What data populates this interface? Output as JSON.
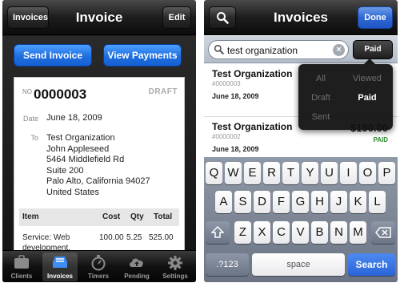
{
  "left_screen": {
    "nav": {
      "back_label": "Invoices",
      "title": "Invoice",
      "edit_label": "Edit"
    },
    "actions": {
      "send_label": "Send Invoice",
      "view_label": "View Payments"
    },
    "invoice": {
      "no_label": "NO",
      "number": "0000003",
      "status": "DRAFT",
      "date_label": "Date",
      "date": "June 18, 2009",
      "to_label": "To",
      "to_lines": [
        "Test Organization",
        "John Appleseed",
        "5464 Middlefield Rd",
        "Suite 200",
        "Palo Alto, California 94027",
        "United States"
      ],
      "table": {
        "headers": [
          "Item",
          "Cost",
          "Qty",
          "Total"
        ],
        "rows": [
          {
            "item": "Service: Web development.",
            "cost": "100.00",
            "qty": "5.25",
            "total": "525.00"
          }
        ]
      }
    },
    "tabs": [
      {
        "label": "Clients",
        "icon": "briefcase-icon",
        "active": false
      },
      {
        "label": "Invoices",
        "icon": "invoice-tray-icon",
        "active": true
      },
      {
        "label": "Timers",
        "icon": "stopwatch-icon",
        "active": false
      },
      {
        "label": "Pending",
        "icon": "cloud-upload-icon",
        "active": false
      },
      {
        "label": "Settings",
        "icon": "gear-icon",
        "active": false
      }
    ]
  },
  "right_screen": {
    "nav": {
      "title": "Invoices",
      "done_label": "Done",
      "search_icon": "search-icon"
    },
    "search": {
      "value": "test organization",
      "filter_label": "Paid"
    },
    "filter_menu": {
      "options": [
        "All",
        "Viewed",
        "Draft",
        "Paid",
        "Sent"
      ],
      "selected": "Paid"
    },
    "invoices": [
      {
        "name": "Test Organization",
        "number": "#0000003",
        "date": "June 18, 2009",
        "amount": "",
        "status": ""
      },
      {
        "name": "Test Organization",
        "number": "#0000002",
        "date": "June 18, 2009",
        "amount": "$190.00",
        "status": "PAID"
      }
    ],
    "keyboard": {
      "row1": [
        "Q",
        "W",
        "E",
        "R",
        "T",
        "Y",
        "U",
        "I",
        "O",
        "P"
      ],
      "row2": [
        "A",
        "S",
        "D",
        "F",
        "G",
        "H",
        "J",
        "K",
        "L"
      ],
      "row3": [
        "Z",
        "X",
        "C",
        "V",
        "B",
        "N",
        "M"
      ],
      "shift_icon": "shift-icon",
      "delete_icon": "delete-icon",
      "numbers_label": ".?123",
      "space_label": "space",
      "search_label": "Search"
    }
  },
  "colors": {
    "accent_blue": "#1e6ee0",
    "paid_green": "#2e8b2e",
    "nav_black": "#1d1d1d"
  }
}
